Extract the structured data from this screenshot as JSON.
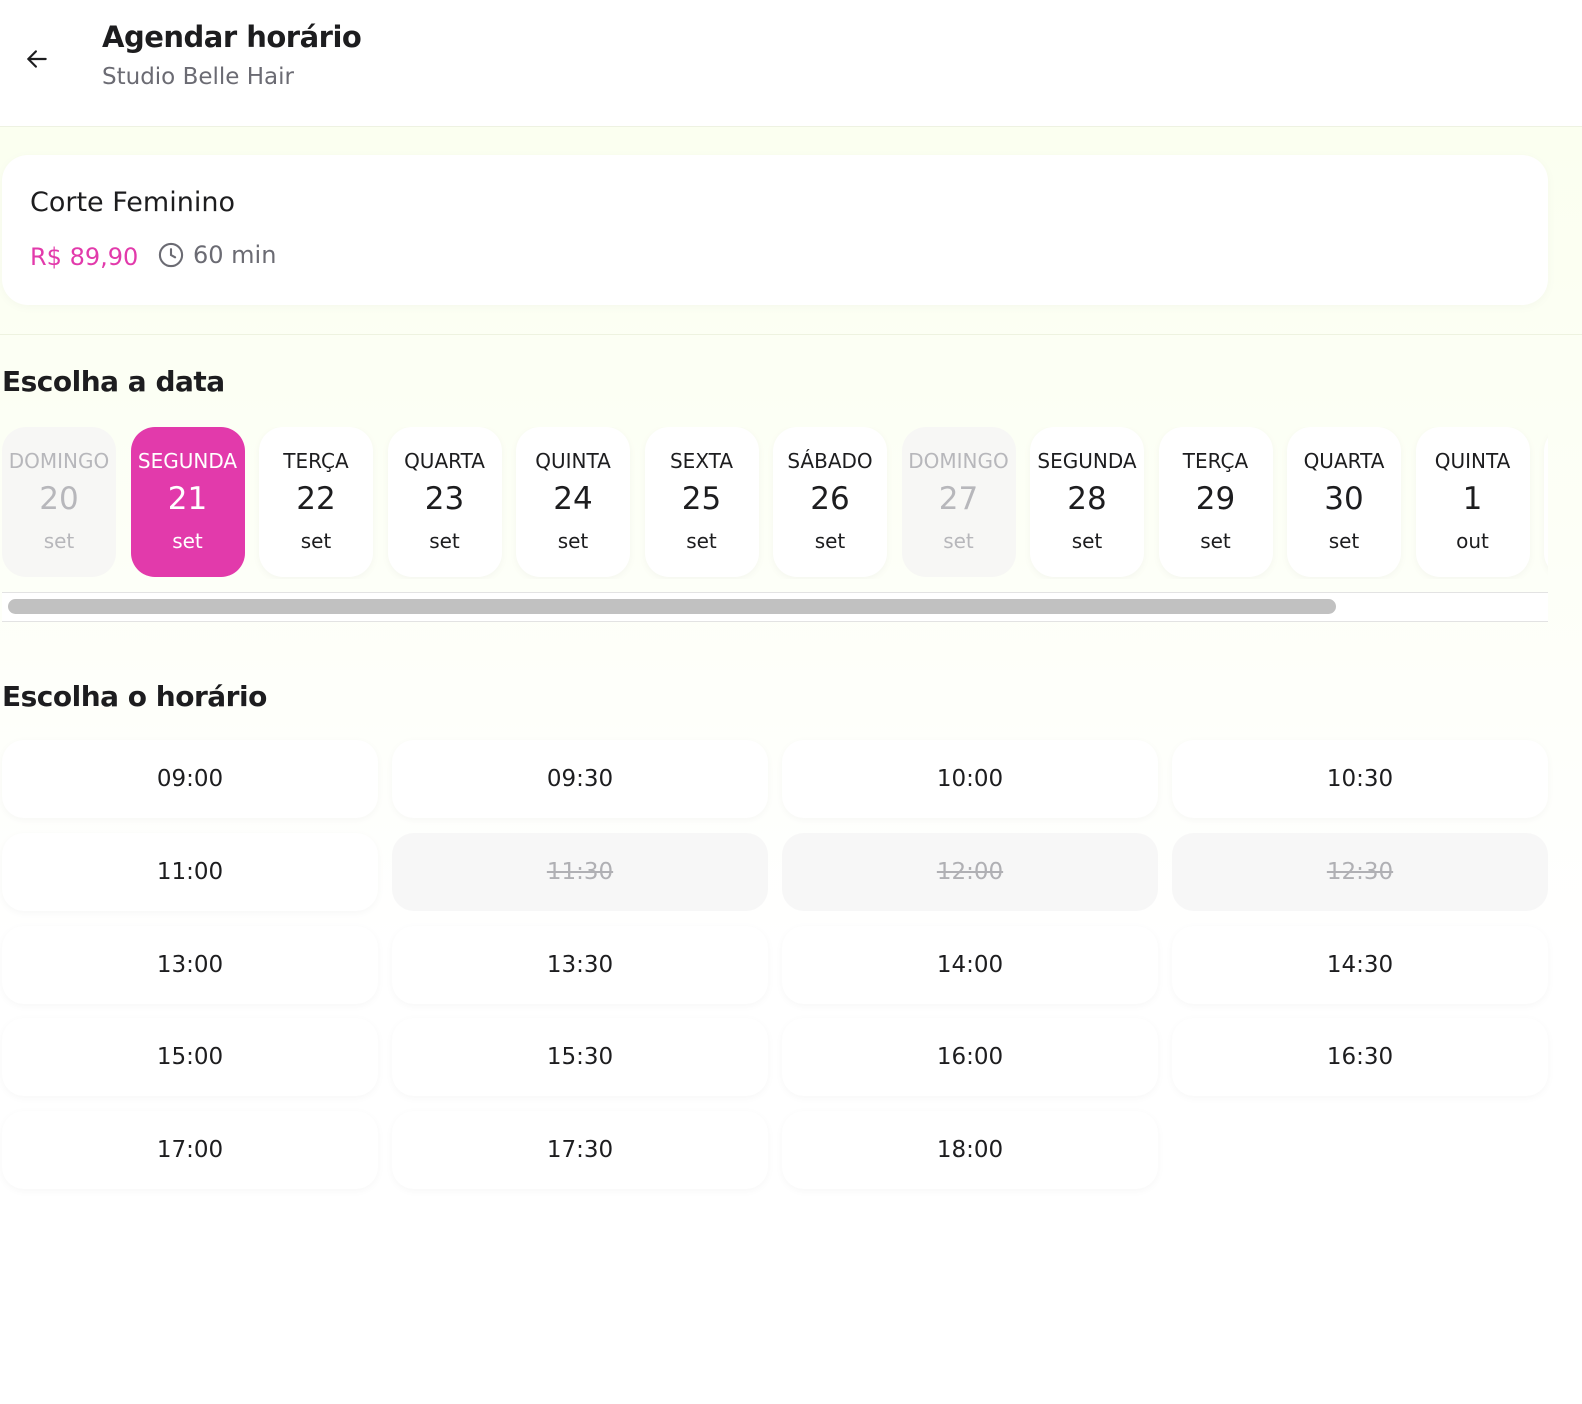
{
  "header": {
    "title": "Agendar horário",
    "subtitle": "Studio Belle Hair"
  },
  "service": {
    "name": "Corte Feminino",
    "price": "R$ 89,90",
    "duration": "60 min"
  },
  "dates_section": {
    "title": "Escolha a data",
    "dates": [
      {
        "weekday": "DOMINGO",
        "day": "20",
        "month": "set",
        "state": "disabled"
      },
      {
        "weekday": "SEGUNDA",
        "day": "21",
        "month": "set",
        "state": "selected"
      },
      {
        "weekday": "TERÇA",
        "day": "22",
        "month": "set",
        "state": "available"
      },
      {
        "weekday": "QUARTA",
        "day": "23",
        "month": "set",
        "state": "available"
      },
      {
        "weekday": "QUINTA",
        "day": "24",
        "month": "set",
        "state": "available"
      },
      {
        "weekday": "SEXTA",
        "day": "25",
        "month": "set",
        "state": "available"
      },
      {
        "weekday": "SÁBADO",
        "day": "26",
        "month": "set",
        "state": "available"
      },
      {
        "weekday": "DOMINGO",
        "day": "27",
        "month": "set",
        "state": "disabled"
      },
      {
        "weekday": "SEGUNDA",
        "day": "28",
        "month": "set",
        "state": "available"
      },
      {
        "weekday": "TERÇA",
        "day": "29",
        "month": "set",
        "state": "available"
      },
      {
        "weekday": "QUARTA",
        "day": "30",
        "month": "set",
        "state": "available"
      },
      {
        "weekday": "QUINTA",
        "day": "1",
        "month": "out",
        "state": "available"
      }
    ]
  },
  "times_section": {
    "title": "Escolha o horário",
    "slots": [
      {
        "time": "09:00",
        "available": true
      },
      {
        "time": "09:30",
        "available": true
      },
      {
        "time": "10:00",
        "available": true
      },
      {
        "time": "10:30",
        "available": true
      },
      {
        "time": "11:00",
        "available": true
      },
      {
        "time": "11:30",
        "available": false
      },
      {
        "time": "12:00",
        "available": false
      },
      {
        "time": "12:30",
        "available": false
      },
      {
        "time": "13:00",
        "available": true
      },
      {
        "time": "13:30",
        "available": true
      },
      {
        "time": "14:00",
        "available": true
      },
      {
        "time": "14:30",
        "available": true
      },
      {
        "time": "15:00",
        "available": true
      },
      {
        "time": "15:30",
        "available": true
      },
      {
        "time": "16:00",
        "available": true
      },
      {
        "time": "16:30",
        "available": true
      },
      {
        "time": "17:00",
        "available": true
      },
      {
        "time": "17:30",
        "available": true
      },
      {
        "time": "18:00",
        "available": true
      }
    ]
  },
  "colors": {
    "accent": "#e23aab",
    "disabled_text": "#b7b7bb"
  },
  "icons": {
    "back": "arrow-left-icon",
    "duration": "clock-icon"
  }
}
